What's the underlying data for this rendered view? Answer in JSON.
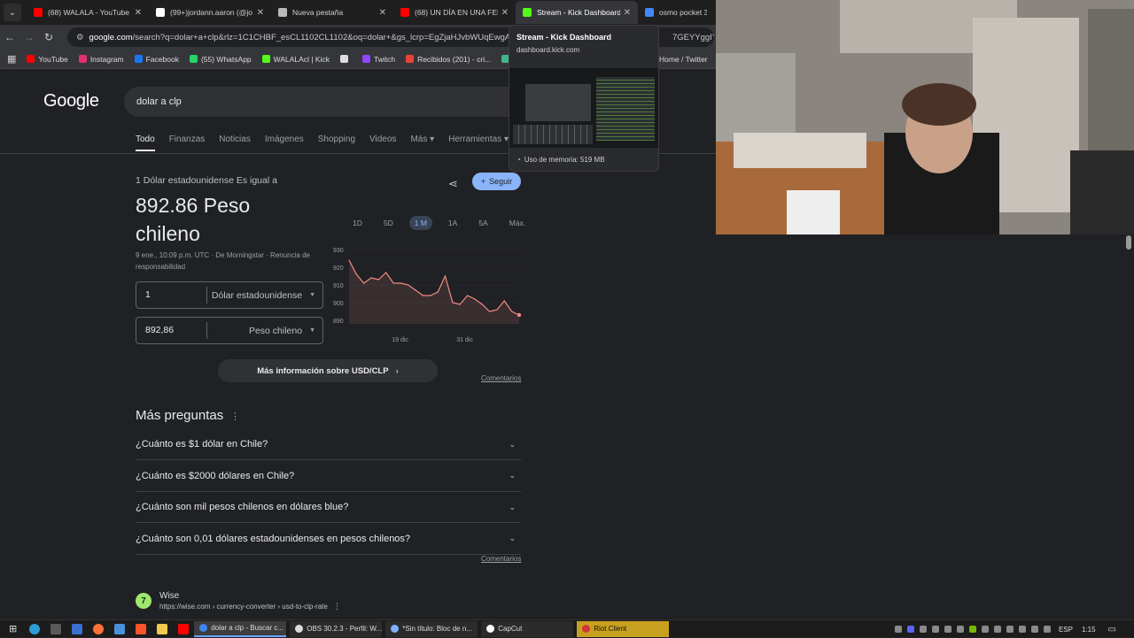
{
  "browser": {
    "tabs": [
      {
        "title": "(68) WALALA - YouTube",
        "color": "#ff0000"
      },
      {
        "title": "(99+)jordann.aaron (@jo",
        "color": "#ffffff"
      },
      {
        "title": "Nueva pestaña",
        "color": "#bbbbbb"
      },
      {
        "title": "(68) UN DÍA EN UNA FER",
        "color": "#ff0000"
      },
      {
        "title": "Stream - Kick Dashboard",
        "color": "#53fc18",
        "active": true
      },
      {
        "title": "osmo pocket 3 - Bu",
        "color": "#4285f4"
      }
    ],
    "url_domain": "google.com",
    "url_rest": "/search?q=dolar+a+clp&rlz=1C1CHBF_esCL1102CL1102&oq=dolar+&gs_lcrp=EgZjaHJvbWUqEwgAEE",
    "url_tail": "7GEYYggIYgAQY",
    "bookmarks": [
      {
        "label": "YouTube",
        "color": "#ff0000"
      },
      {
        "label": "Instagram",
        "color": "#e1306c"
      },
      {
        "label": "Facebook",
        "color": "#1877f2"
      },
      {
        "label": "(55) WhatsApp",
        "color": "#25d366"
      },
      {
        "label": "WALALAcl | Kick",
        "color": "#53fc18"
      },
      {
        "label": "",
        "color": "#dddddd"
      },
      {
        "label": "Twitch",
        "color": "#9146ff"
      },
      {
        "label": "Recibidos (201) - cri...",
        "color": "#ea4335"
      },
      {
        "label": "(14",
        "color": "#3fb68b"
      }
    ],
    "bookmark_right": "Home / Twitter"
  },
  "hovercard": {
    "title": "Stream - Kick Dashboard",
    "domain": "dashboard.kick.com",
    "memory": "Uso de memoria: 519 MB"
  },
  "search": {
    "logo": "Google",
    "query": "dolar a clp",
    "tabs": [
      "Todo",
      "Finanzas",
      "Noticias",
      "Imágenes",
      "Shopping",
      "Videos",
      "Más ▾",
      "Herramientas ▾"
    ]
  },
  "converter": {
    "equals_text": "1 Dólar estadounidense Es igual a",
    "rate_text": "892.86 Peso chileno",
    "meta": "9 ene., 10:09 p.m. UTC · De Morningstar · Renuncia de responsabilidad",
    "follow": "Seguir",
    "from_amount": "1",
    "from_currency": "Dólar estadounidense",
    "to_amount": "892,86",
    "to_currency": "Peso chileno",
    "ranges": [
      "1D",
      "5D",
      "1 M",
      "1A",
      "5A",
      "Máx."
    ],
    "selected_range": "1 M",
    "more_info": "Más información sobre USD/CLP",
    "comments": "Comentarios"
  },
  "chart_data": {
    "type": "line",
    "title": "",
    "xlabel": "",
    "ylabel": "",
    "ylim": [
      888,
      932
    ],
    "yticks": [
      930,
      920,
      910,
      900,
      890
    ],
    "xtick_labels": [
      "19 dic",
      "31 dic"
    ],
    "series": [
      {
        "name": "",
        "color": "#f28b82",
        "values": [
          924,
          916,
          911,
          914,
          913,
          917,
          911,
          911,
          910,
          907,
          904,
          904,
          906,
          915,
          900,
          899,
          904,
          902,
          899,
          895,
          896,
          901,
          895,
          893
        ]
      }
    ]
  },
  "questions": {
    "title": "Más preguntas",
    "items": [
      "¿Cuánto es $1 dólar en Chile?",
      "¿Cuánto es $2000 dólares en Chile?",
      "¿Cuánto son mil pesos chilenos en dólares blue?",
      "¿Cuánto son 0,01 dólares estadounidenses en pesos chilenos?"
    ],
    "comments": "Comentarios"
  },
  "result": {
    "name": "Wise",
    "url": "https://wise.com › currency-converter › usd-to-clp-rate"
  },
  "taskbar": {
    "apps": [
      {
        "label": "dolar a clp - Buscar c...",
        "color": "#4285f4",
        "active": true
      },
      {
        "label": "OBS 30.2.3 - Perfil: W...",
        "color": "#dddddd"
      },
      {
        "label": "*Sin título: Bloc de n...",
        "color": "#7fb3ff"
      },
      {
        "label": "CapCut",
        "color": "#ffffff"
      },
      {
        "label": "Riot Client",
        "color": "#d13639",
        "riot": true
      }
    ],
    "lang": "ESP",
    "time": "1:15"
  }
}
